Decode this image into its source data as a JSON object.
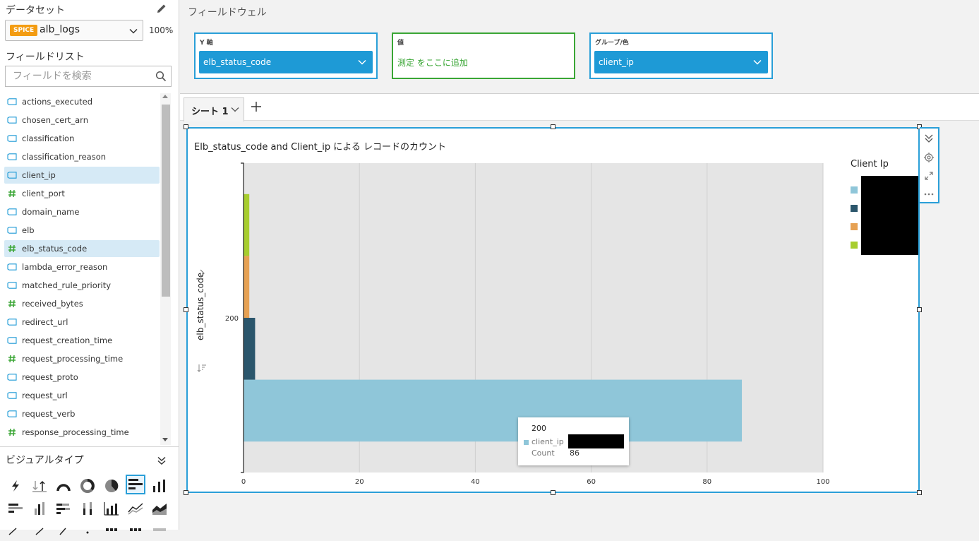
{
  "sidebar": {
    "dataset_title": "データセット",
    "dataset_badge": "SPICE",
    "dataset_name": "alb_logs",
    "dataset_percent": "100%",
    "field_list_title": "フィールドリスト",
    "search_placeholder": "フィールドを検索",
    "fields": [
      {
        "label": "actions_executed",
        "type": "dimension",
        "selected": false
      },
      {
        "label": "chosen_cert_arn",
        "type": "dimension",
        "selected": false
      },
      {
        "label": "classification",
        "type": "dimension",
        "selected": false
      },
      {
        "label": "classification_reason",
        "type": "dimension",
        "selected": false
      },
      {
        "label": "client_ip",
        "type": "dimension",
        "selected": true
      },
      {
        "label": "client_port",
        "type": "measure",
        "selected": false
      },
      {
        "label": "domain_name",
        "type": "dimension",
        "selected": false
      },
      {
        "label": "elb",
        "type": "dimension",
        "selected": false
      },
      {
        "label": "elb_status_code",
        "type": "measure",
        "selected": true
      },
      {
        "label": "lambda_error_reason",
        "type": "dimension",
        "selected": false
      },
      {
        "label": "matched_rule_priority",
        "type": "dimension",
        "selected": false
      },
      {
        "label": "received_bytes",
        "type": "measure",
        "selected": false
      },
      {
        "label": "redirect_url",
        "type": "dimension",
        "selected": false
      },
      {
        "label": "request_creation_time",
        "type": "dimension",
        "selected": false
      },
      {
        "label": "request_processing_time",
        "type": "measure",
        "selected": false
      },
      {
        "label": "request_proto",
        "type": "dimension",
        "selected": false
      },
      {
        "label": "request_url",
        "type": "dimension",
        "selected": false
      },
      {
        "label": "request_verb",
        "type": "dimension",
        "selected": false
      },
      {
        "label": "response_processing_time",
        "type": "measure",
        "selected": false
      }
    ],
    "visual_types_title": "ビジュアルタイプ"
  },
  "field_wells": {
    "title": "フィールドウェル",
    "y_axis": {
      "label": "Y 軸",
      "value": "elb_status_code"
    },
    "value": {
      "label": "値",
      "placeholder": "測定 をここに追加"
    },
    "group_color": {
      "label": "グループ/色",
      "value": "client_ip"
    }
  },
  "sheet_tabs": [
    {
      "label": "シート 1"
    }
  ],
  "visual": {
    "title": "Elb_status_code and Client_ip による レコードのカウント"
  },
  "tooltip": {
    "header": "200",
    "field_label": "client_ip",
    "count_label": "Count",
    "count_value": "86"
  },
  "colors": {
    "accent": "#2a9fd8",
    "series": [
      "#8fc6d9",
      "#2b566c",
      "#e6a153",
      "#a7cd2e"
    ],
    "dimension_icon": "#1e9ad6",
    "measure_icon": "#3aa635"
  },
  "chart_data": {
    "type": "bar",
    "orientation": "horizontal",
    "stacked": true,
    "categories": [
      "200"
    ],
    "legend_title": "Client Ip",
    "series": [
      {
        "values": [
          86
        ]
      },
      {
        "values": [
          2
        ]
      },
      {
        "values": [
          1
        ]
      },
      {
        "values": [
          1
        ]
      }
    ],
    "ylabel": "elb_status_code",
    "xlabel": "",
    "xlim": [
      0,
      100
    ],
    "xticks": [
      0,
      20,
      40,
      60,
      80,
      100
    ],
    "grid": true,
    "legend_position": "right"
  }
}
